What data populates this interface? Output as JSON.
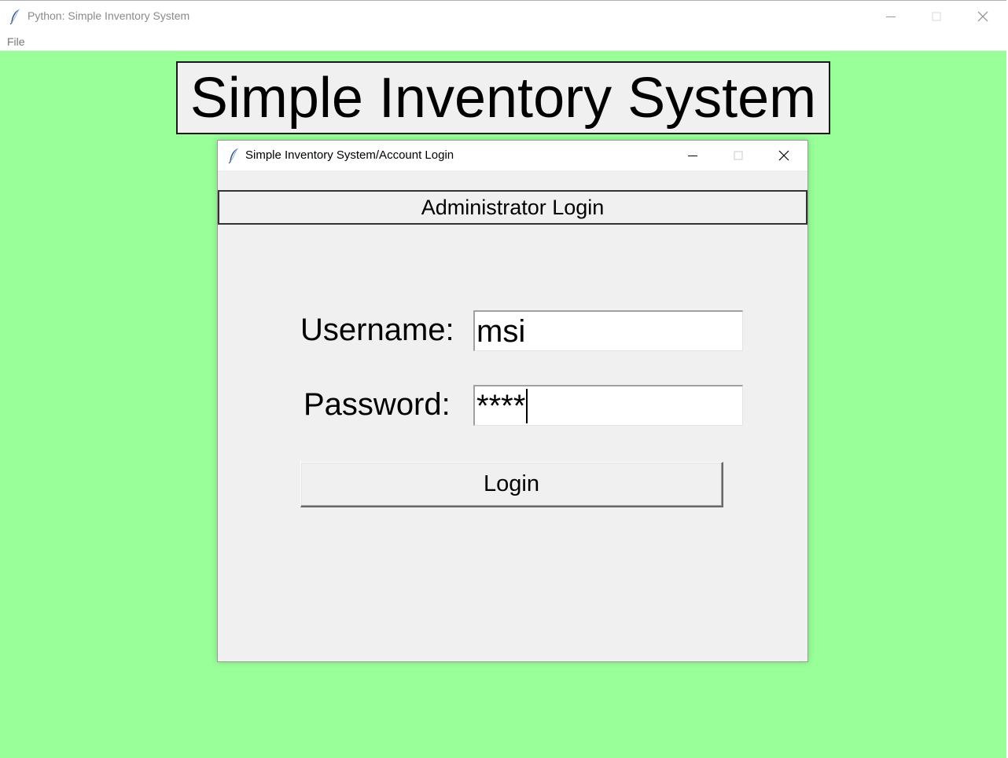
{
  "window": {
    "title": "Python: Simple Inventory System",
    "icon": "feather-icon",
    "controls": [
      "minimize-icon",
      "maximize-icon",
      "close-icon"
    ]
  },
  "menubar": {
    "items": [
      {
        "label": "File"
      }
    ]
  },
  "banner": {
    "title": "Simple Inventory System"
  },
  "login_dialog": {
    "title": "Simple Inventory System/Account Login",
    "icon": "feather-icon",
    "header": "Administrator Login",
    "username_label": "Username:",
    "username_value": "msi",
    "password_label": "Password:",
    "password_value": "****",
    "login_button": "Login"
  },
  "colors": {
    "background": "#99ff99",
    "panel": "#f0f0f0"
  }
}
